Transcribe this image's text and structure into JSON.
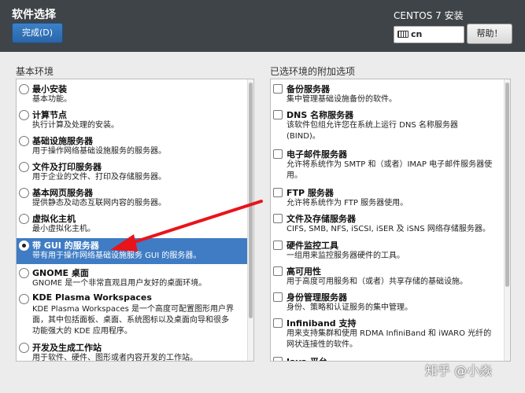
{
  "header": {
    "title": "软件选择",
    "done_label": "完成(D)",
    "product": "CENTOS 7 安装",
    "keyboard": "cn",
    "help_label": "帮助！",
    "keyboard_icon": "keyboard-icon"
  },
  "left": {
    "title": "基本环境",
    "items": [
      {
        "name": "最小安装",
        "desc": "基本功能。"
      },
      {
        "name": "计算节点",
        "desc": "执行计算及处理的安装。"
      },
      {
        "name": "基础设施服务器",
        "desc": "用于操作网络基础设施服务的服务器。"
      },
      {
        "name": "文件及打印服务器",
        "desc": "用于企业的文件、打印及存储服务器。"
      },
      {
        "name": "基本网页服务器",
        "desc": "提供静态及动态互联网内容的服务器。"
      },
      {
        "name": "虚拟化主机",
        "desc": "最小虚拟化主机。"
      },
      {
        "name": "带 GUI 的服务器",
        "desc": "带有用于操作网络基础设施服务 GUI 的服务器。"
      },
      {
        "name": "GNOME 桌面",
        "desc": "GNOME 是一个非常直观且用户友好的桌面环境。"
      },
      {
        "name": "KDE Plasma Workspaces",
        "desc": "KDE Plasma Workspaces 是一个高度可配置图形用户界\n面，其中包括面板、桌面、系统图标以及桌面向导和很多\n功能强大的 KDE 应用程序。"
      },
      {
        "name": "开发及生成工作站",
        "desc": "用于软件、硬件、图形或者内容开发的工作站。"
      }
    ]
  },
  "right": {
    "title": "已选环境的附加选项",
    "items": [
      {
        "name": "备份服务器",
        "desc": "集中管理基础设施备份的软件。"
      },
      {
        "name": "DNS 名称服务器",
        "desc": "该软件包组允许您在系统上运行 DNS 名称服务器\n(BIND)。"
      },
      {
        "name": "电子邮件服务器",
        "desc": "允许将系统作为 SMTP 和（或者）IMAP 电子邮件服务器使\n用。"
      },
      {
        "name": "FTP 服务器",
        "desc": "允许将系统作为 FTP 服务器使用。"
      },
      {
        "name": "文件及存储服务器",
        "desc": "CIFS, SMB, NFS, iSCSI, iSER 及 iSNS 网络存储服务器。"
      },
      {
        "name": "硬件监控工具",
        "desc": "一组用来监控服务器硬件的工具。"
      },
      {
        "name": "高可用性",
        "desc": "用于高度可用服务和（或者）共享存储的基础设施。"
      },
      {
        "name": "身份管理服务器",
        "desc": "身份、策略和认证服务的集中管理。"
      },
      {
        "name": "Infiniband 支持",
        "desc": "用来支持集群和使用 RDMA InfiniBand 和 iWARO 光纤的\n网状连接性的软件。"
      },
      {
        "name": "Java 平台",
        "desc": ""
      }
    ]
  },
  "watermark": "知乎 @小焱"
}
